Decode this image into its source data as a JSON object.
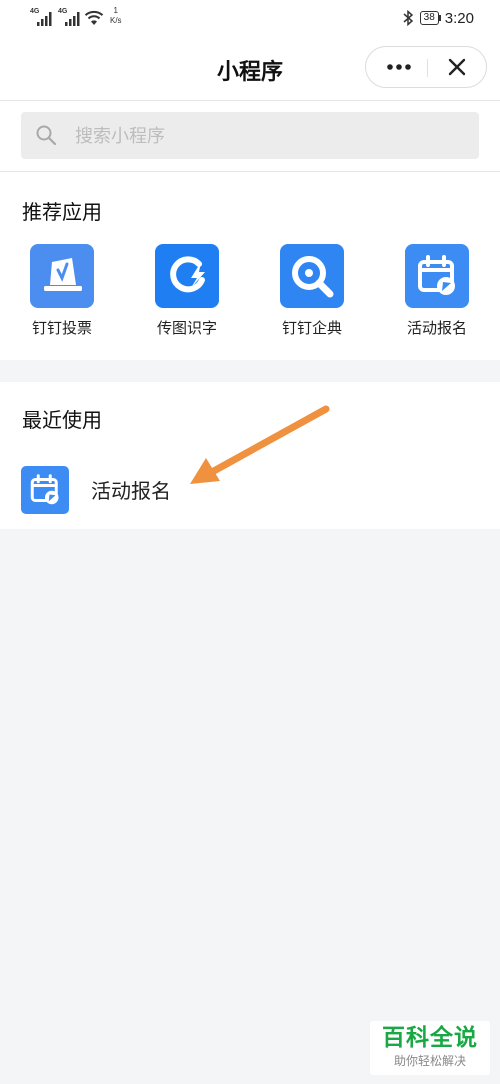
{
  "status_bar": {
    "signal_1": "4G",
    "signal_2": "4G",
    "speed_value": "1",
    "speed_unit": "K/s",
    "battery": "38",
    "time": "3:20"
  },
  "nav": {
    "title": "小程序"
  },
  "search": {
    "placeholder": "搜索小程序"
  },
  "recommended": {
    "title": "推荐应用",
    "apps": [
      {
        "label": "钉钉投票",
        "icon": "vote-ticket-icon"
      },
      {
        "label": "传图识字",
        "icon": "image-ocr-icon"
      },
      {
        "label": "钉钉企典",
        "icon": "enterprise-search-icon"
      },
      {
        "label": "活动报名",
        "icon": "calendar-signup-icon"
      }
    ]
  },
  "recent": {
    "title": "最近使用",
    "items": [
      {
        "label": "活动报名",
        "icon": "calendar-signup-icon"
      }
    ]
  },
  "annotation": {
    "arrow_color": "#f0913f"
  },
  "watermark": {
    "main": "百科全说",
    "sub": "助你轻松解决"
  },
  "colors": {
    "accent_blue": "#3d8cf4",
    "watermark_green": "#1aa845"
  }
}
